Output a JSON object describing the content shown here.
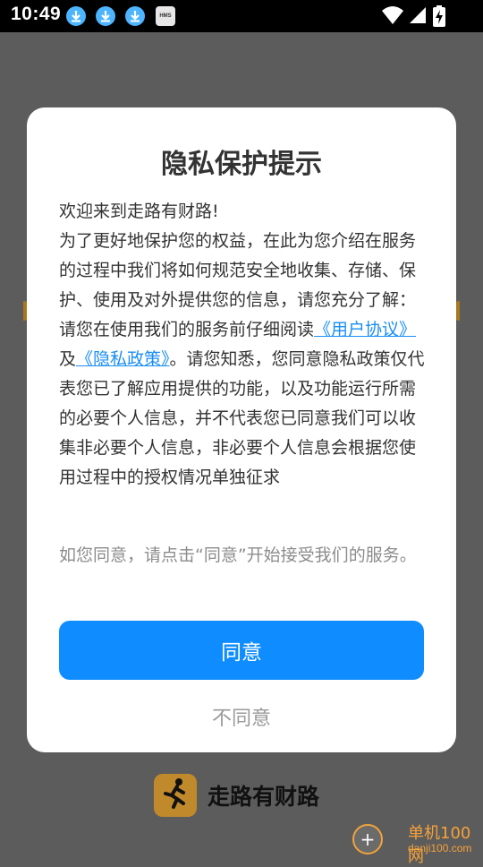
{
  "status_bar": {
    "time": "10:49",
    "hms_label": "HMS",
    "icons": [
      "download-icon",
      "download-icon",
      "download-icon",
      "hms-icon",
      "wifi-icon",
      "signal-icon",
      "battery-charging-icon"
    ]
  },
  "dialog": {
    "title": "隐私保护提示",
    "body": {
      "greeting": "欢迎来到走路有财路!",
      "intro": "为了更好地保护您的权益，在此为您介绍在服务的过程中我们将如何规范安全地收集、存储、保护、使用及对外提供您的信息，请您充分了解：",
      "read_prefix": "请您在使用我们的服务前仔细阅读",
      "user_agreement_link": "《用户协议》",
      "and": "及",
      "privacy_policy_link": "《隐私政策》",
      "read_suffix": "。请您知悉，您同意隐私政策仅代表您已了解应用提供的功能，以及功能运行所需的必要个人信息，并不代表您已同意我们可以收集非必要个人信息，非必要个人信息会根据您使用过程中的授权情况单独征求"
    },
    "note": "如您同意，请点击“同意”开始接受我们的服务。",
    "agree_label": "同意",
    "disagree_label": "不同意"
  },
  "footer": {
    "app_name": "走路有财路",
    "logo_text": "走路有财路"
  },
  "watermark": {
    "title": "单机100网",
    "url": "danji100.com"
  },
  "colors": {
    "accent": "#0f8cff",
    "link": "#1a8ef6",
    "overlay": "#5c5c5c"
  }
}
